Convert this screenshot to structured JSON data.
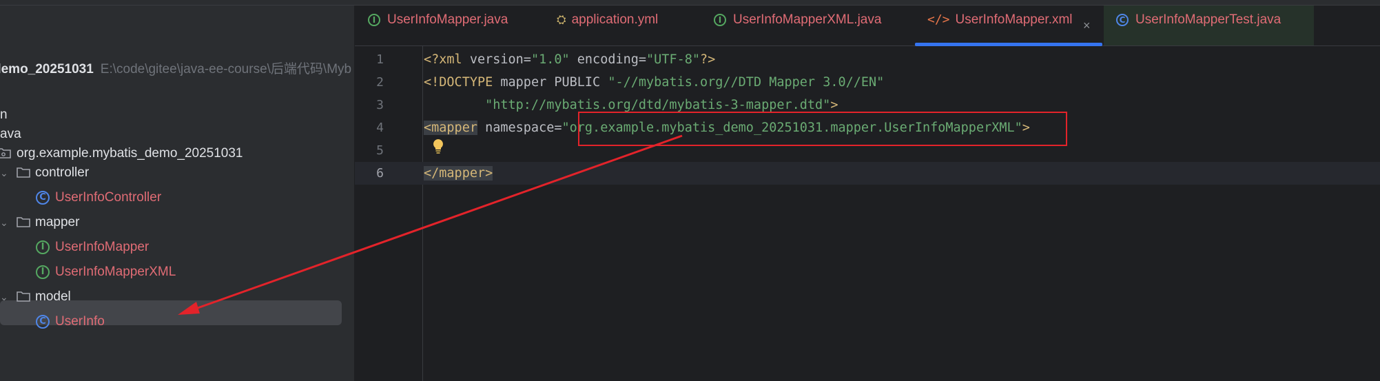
{
  "sidebar": {
    "project_name": "demo_20251031",
    "project_path": "E:\\code\\gitee\\java-ee-course\\后端代码\\Myb",
    "rows": {
      "main": "n",
      "java": "ava",
      "package": "org.example.mybatis_demo_20251031",
      "controller": "controller",
      "controller_class": "UserInfoController",
      "mapper": "mapper",
      "mapper_iface": "UserInfoMapper",
      "mapper_xml_iface": "UserInfoMapperXML",
      "model": "model",
      "model_class": "UserInfo"
    },
    "icons": {
      "class_glyph": "C",
      "interface_glyph": "I",
      "chevron": "⌄"
    }
  },
  "tabs": [
    {
      "label": "UserInfoMapper.java",
      "icon": "interface-icon"
    },
    {
      "label": "application.yml",
      "icon": "yaml-icon"
    },
    {
      "label": "UserInfoMapperXML.java",
      "icon": "interface-icon"
    },
    {
      "label": "UserInfoMapper.xml",
      "icon": "xml-icon"
    },
    {
      "label": "UserInfoMapperTest.java",
      "icon": "test-class-icon"
    }
  ],
  "tab_close_glyph": "×",
  "editor": {
    "line_numbers": [
      "1",
      "2",
      "3",
      "4",
      "5",
      "6"
    ],
    "line1": {
      "a": "<?xml ",
      "b": "version=",
      "c": "\"1.0\"",
      "d": " encoding=",
      "e": "\"UTF-8\"",
      "f": "?>"
    },
    "line2": {
      "a": "<!DOCTYPE ",
      "b": "mapper PUBLIC ",
      "c": "\"-//mybatis.org//DTD Mapper 3.0//EN\""
    },
    "line3": {
      "indent": "        ",
      "c": "\"http://mybatis.org/dtd/mybatis-3-mapper.dtd\"",
      "d": ">"
    },
    "line4": {
      "a": "<mapper",
      "b": " namespace=",
      "c": "\"org.example.mybatis_demo_20251031.mapper.UserInfoMapperXML\"",
      "d": ">"
    },
    "line6": {
      "a": "</mapper>"
    },
    "current_line": "6"
  },
  "annotation": {
    "box_color": "#e3232a",
    "arrow_color": "#e3232a"
  },
  "colors": {
    "tab_active_underline": "#3574f0",
    "file_name": "#e06c75",
    "xml_tag": "#d5b778",
    "xml_string": "#6aab73"
  }
}
